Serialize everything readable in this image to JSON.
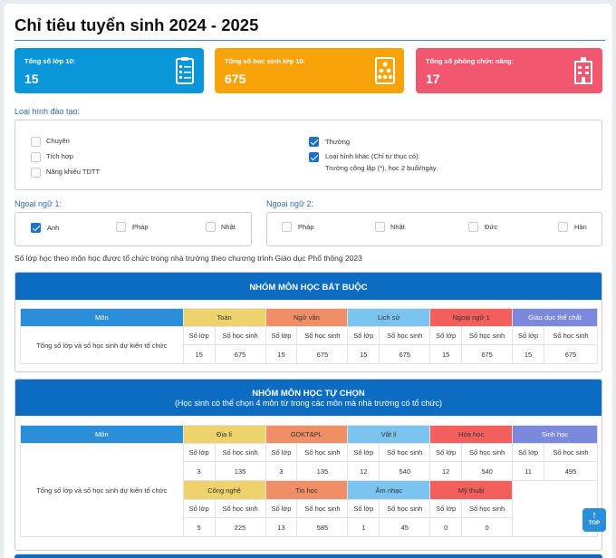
{
  "page_title": "Chỉ tiêu tuyển sinh 2024 - 2025",
  "cards": [
    {
      "label": "Tổng số lớp 10:",
      "value": "15",
      "icon": "checklist-icon",
      "color": "#0a96d8"
    },
    {
      "label": "Tổng số học sinh lớp 10:",
      "value": "675",
      "icon": "students-icon",
      "color": "#f9a30b"
    },
    {
      "label": "Tổng số phòng chức năng:",
      "value": "17",
      "icon": "building-icon",
      "color": "#f0566d"
    }
  ],
  "training": {
    "heading": "Loại hình đào tạo:",
    "left": [
      {
        "label": "Chuyên",
        "checked": false
      },
      {
        "label": "Tích hợp",
        "checked": false
      },
      {
        "label": "Năng khiếu TDTT",
        "checked": false
      }
    ],
    "right": [
      {
        "label": "Thường",
        "checked": true
      },
      {
        "label": "Loại hình khác (Chỉ tư thục có):",
        "note": "Trường công lập (*), học 2 buổi/ngày.",
        "checked": true
      }
    ]
  },
  "lang1": {
    "heading": "Ngoại ngữ 1:",
    "options": [
      {
        "label": "Anh",
        "checked": true
      },
      {
        "label": "Pháp",
        "checked": false
      },
      {
        "label": "Nhật",
        "checked": false
      }
    ]
  },
  "lang2": {
    "heading": "Ngoại ngữ 2:",
    "options": [
      {
        "label": "Pháp",
        "checked": false
      },
      {
        "label": "Nhật",
        "checked": false
      },
      {
        "label": "Đức",
        "checked": false
      },
      {
        "label": "Hàn",
        "checked": false
      }
    ]
  },
  "intro": "Số lớp học theo môn học được tổ chức trong nhà trường theo chương trình Giáo dục Phổ thông 2023",
  "col_mon": "Môn",
  "row_label": "Tổng số lớp và số học sinh dự kiến tổ chức",
  "col_classes": "Số lớp",
  "col_students": "Số học sinh",
  "required": {
    "title": "NHÓM MÔN HỌC BẮT BUỘC",
    "subjects": [
      {
        "name": "Toán",
        "classes": "15",
        "students": "675"
      },
      {
        "name": "Ngữ văn",
        "classes": "15",
        "students": "675"
      },
      {
        "name": "Lịch sử",
        "classes": "15",
        "students": "675"
      },
      {
        "name": "Ngoại ngữ 1",
        "classes": "15",
        "students": "675"
      },
      {
        "name": "Giáo dục thể chất",
        "classes": "15",
        "students": "675"
      }
    ]
  },
  "elective": {
    "title": "NHÓM MÔN HỌC TỰ CHỌN",
    "subtitle": "(Học sinh có thể chọn 4 môn từ trong các môn mà nhà trường có tổ chức)",
    "row1": [
      {
        "name": "Địa lí",
        "classes": "3",
        "students": "135"
      },
      {
        "name": "GDKT&PL",
        "classes": "3",
        "students": "135"
      },
      {
        "name": "Vật lí",
        "classes": "12",
        "students": "540"
      },
      {
        "name": "Hóa học",
        "classes": "12",
        "students": "540"
      },
      {
        "name": "Sinh học",
        "classes": "11",
        "students": "495"
      }
    ],
    "row2": [
      {
        "name": "Công nghệ",
        "classes": "5",
        "students": "225"
      },
      {
        "name": "Tin học",
        "classes": "13",
        "students": "585"
      },
      {
        "name": "Âm nhạc",
        "classes": "1",
        "students": "45"
      },
      {
        "name": "Mỹ thuật",
        "classes": "0",
        "students": "0"
      }
    ]
  },
  "top_button": {
    "label": "TOP",
    "icon": "arrow-up-icon"
  }
}
